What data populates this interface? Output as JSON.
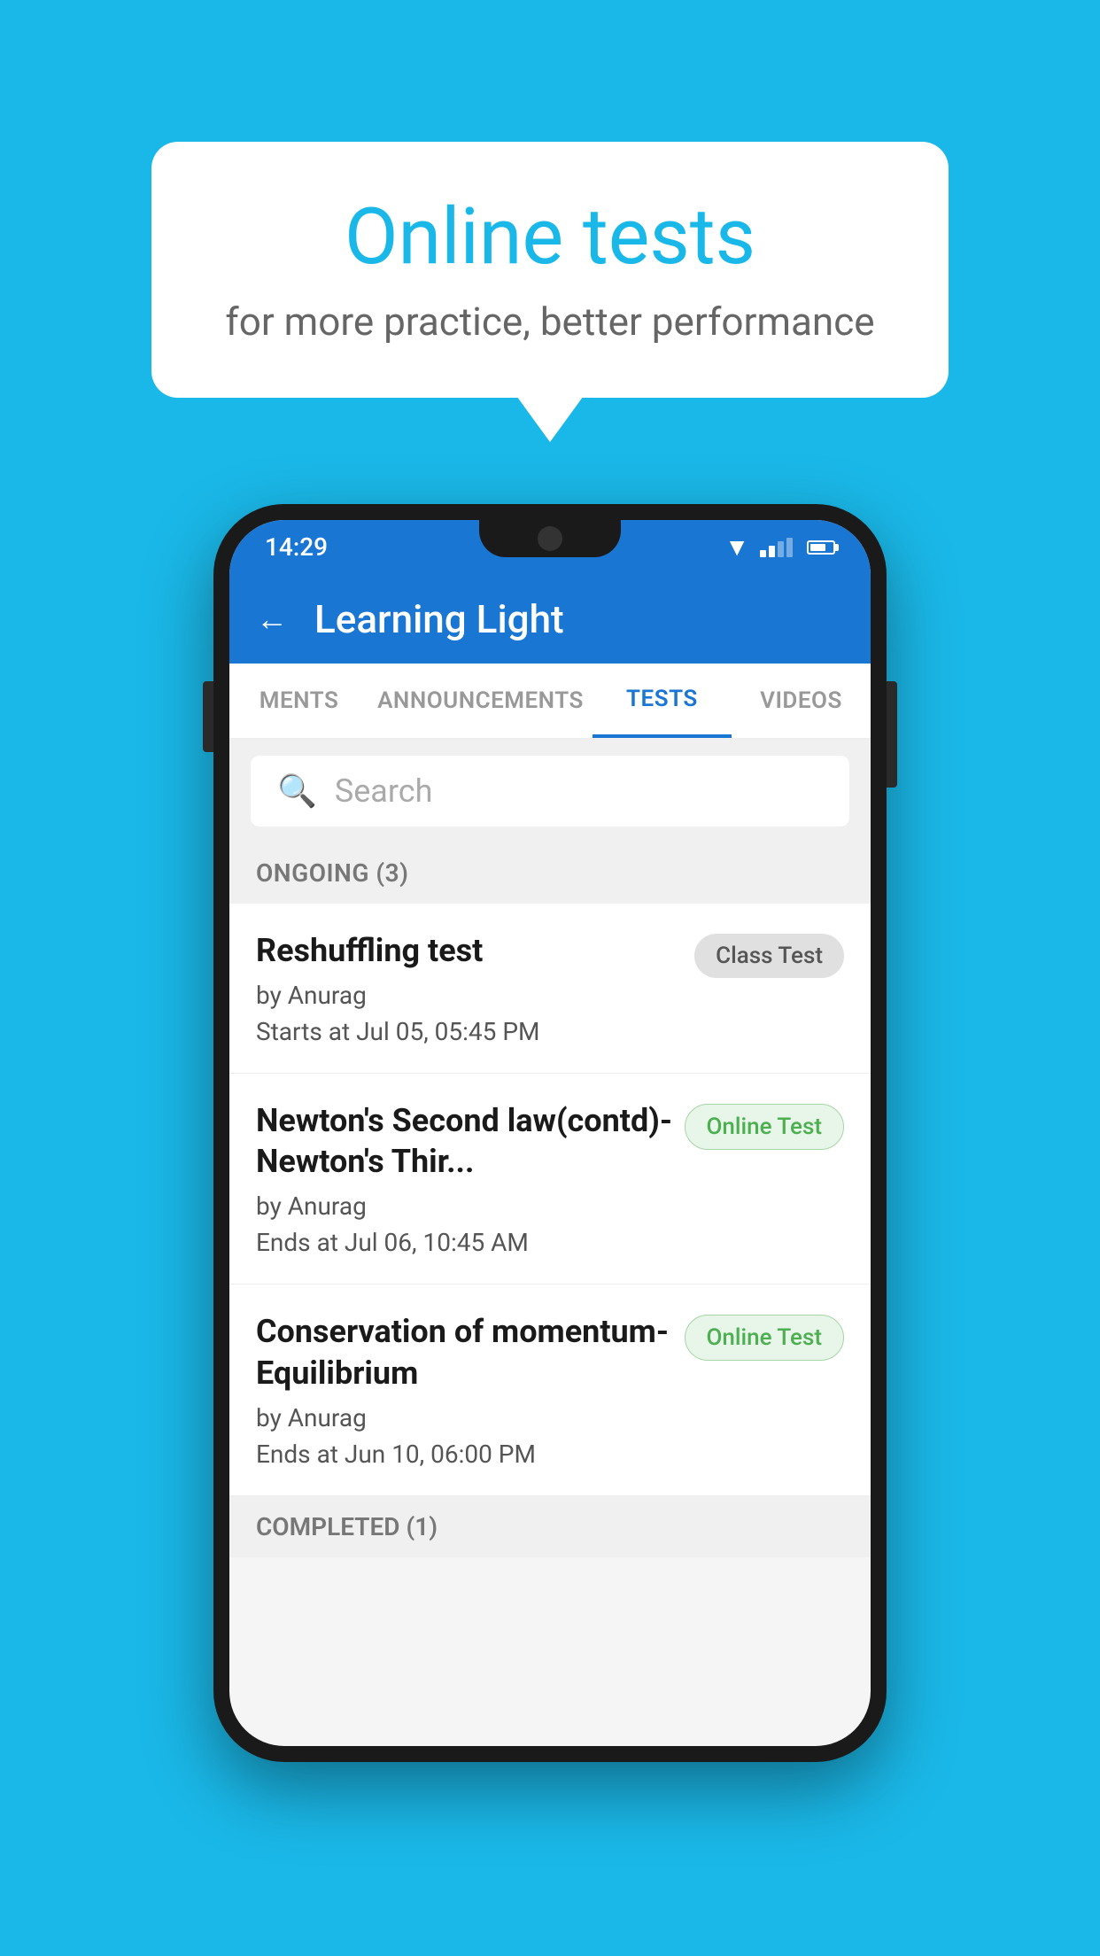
{
  "background_color": "#1ab8e8",
  "hero": {
    "bubble_title": "Online tests",
    "bubble_subtitle": "for more practice, better performance"
  },
  "status_bar": {
    "time": "14:29"
  },
  "app_header": {
    "title": "Learning Light",
    "back_label": "←"
  },
  "tabs": [
    {
      "id": "ments",
      "label": "MENTS",
      "active": false
    },
    {
      "id": "announcements",
      "label": "ANNOUNCEMENTS",
      "active": false
    },
    {
      "id": "tests",
      "label": "TESTS",
      "active": true
    },
    {
      "id": "videos",
      "label": "VIDEOS",
      "active": false
    }
  ],
  "search": {
    "placeholder": "Search"
  },
  "ongoing_section": {
    "title": "ONGOING (3)",
    "tests": [
      {
        "name": "Reshuffling test",
        "author": "by Anurag",
        "date": "Starts at  Jul 05, 05:45 PM",
        "badge": "Class Test",
        "badge_type": "class"
      },
      {
        "name": "Newton's Second law(contd)-Newton's Thir...",
        "author": "by Anurag",
        "date": "Ends at  Jul 06, 10:45 AM",
        "badge": "Online Test",
        "badge_type": "online"
      },
      {
        "name": "Conservation of momentum-Equilibrium",
        "author": "by Anurag",
        "date": "Ends at  Jun 10, 06:00 PM",
        "badge": "Online Test",
        "badge_type": "online"
      }
    ]
  },
  "completed_section": {
    "title": "COMPLETED (1)"
  }
}
